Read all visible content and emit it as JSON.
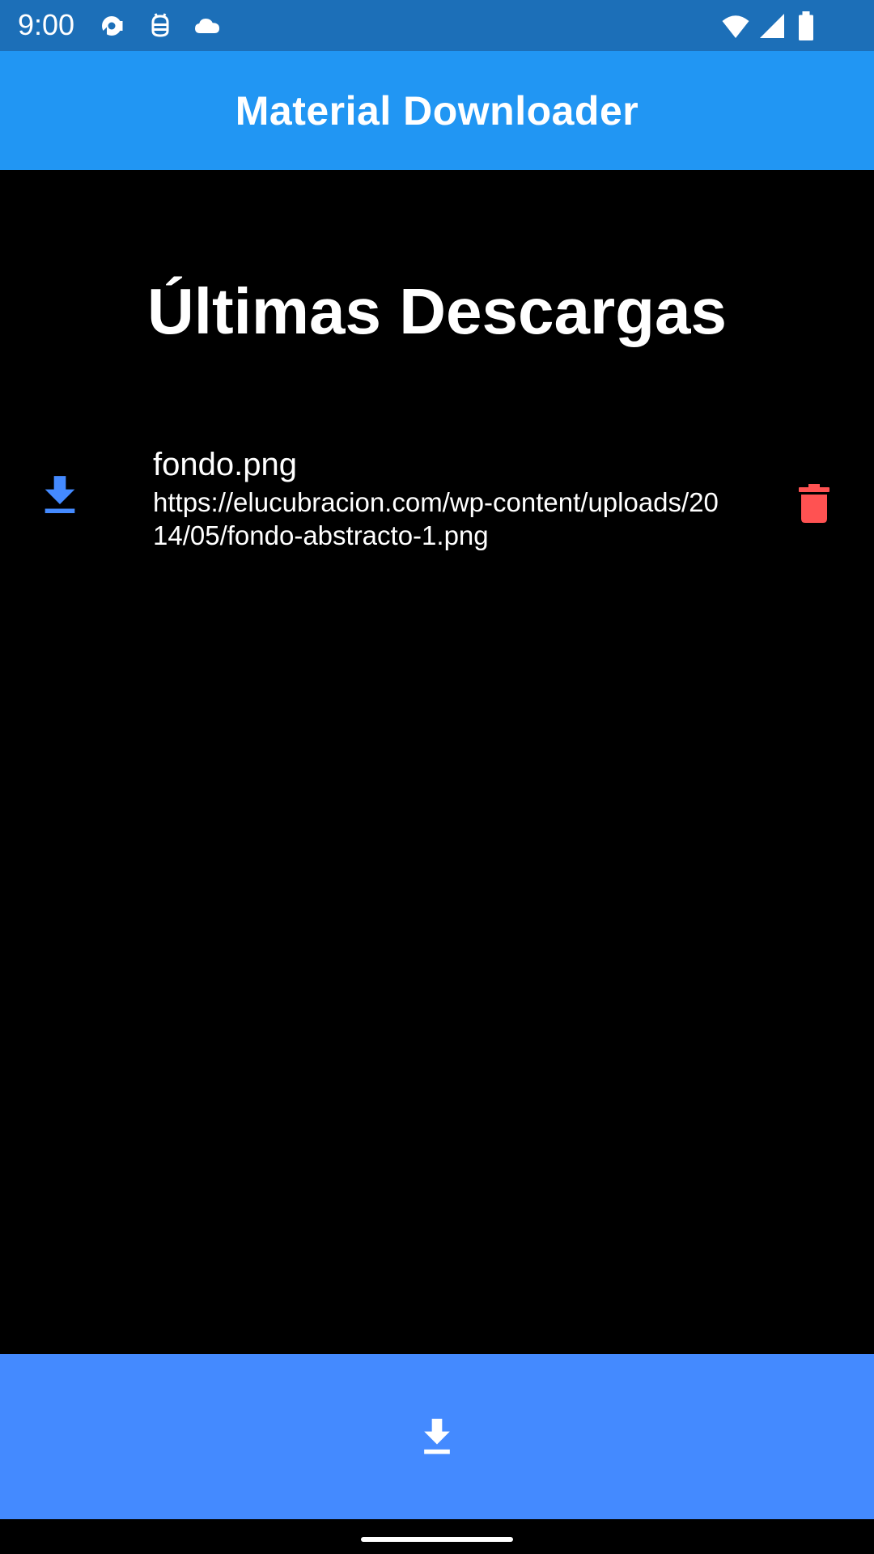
{
  "status_bar": {
    "time": "9:00",
    "left_icons": [
      "sync-notification-icon",
      "android-debug-icon",
      "cloud-icon"
    ],
    "right_icons": [
      "wifi-icon",
      "cellular-signal-icon",
      "battery-icon"
    ],
    "background": "#1c6fb8"
  },
  "app_bar": {
    "title": "Material Downloader",
    "background": "#2196f3"
  },
  "main": {
    "heading": "Últimas Descargas",
    "downloads": [
      {
        "icon": "download-icon",
        "title": "fondo.png",
        "url": "https://elucubracion.com/wp-content/uploads/2014/05/fondo-abstracto-1.png",
        "action_icon": "trash-icon"
      }
    ]
  },
  "bottom_bar": {
    "icon": "download-icon",
    "background": "#448aff"
  },
  "colors": {
    "accent": "#448aff",
    "leading_icon": "#448aff",
    "delete": "#ff5252",
    "background": "#000000"
  }
}
